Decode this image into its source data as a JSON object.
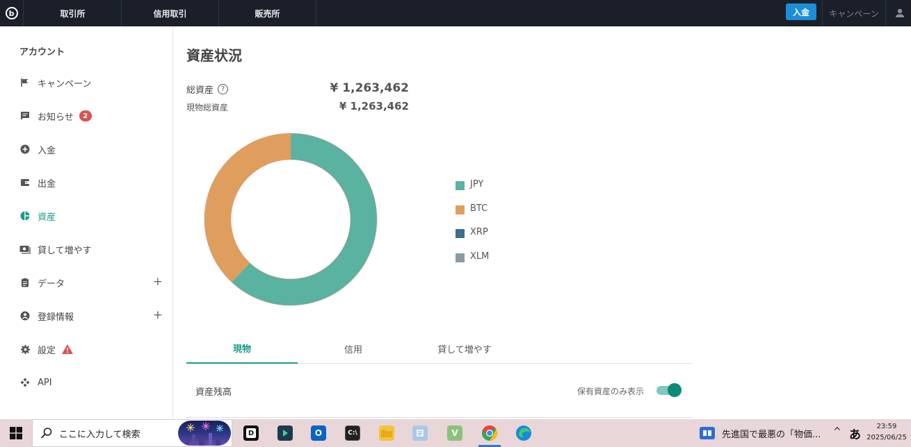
{
  "topbar": {
    "tabs": [
      "取引所",
      "信用取引",
      "販売所"
    ],
    "deposit_label": "入金",
    "campaign_label": "キャンペーン"
  },
  "sidebar": {
    "title": "アカウント",
    "items": [
      {
        "label": "キャンペーン",
        "icon": "flag-icon"
      },
      {
        "label": "お知らせ",
        "icon": "message-icon",
        "badge": "2"
      },
      {
        "label": "入金",
        "icon": "plus-circle-icon"
      },
      {
        "label": "出金",
        "icon": "wallet-icon"
      },
      {
        "label": "資産",
        "icon": "pie-chart-icon",
        "active": true
      },
      {
        "label": "貸して増やす",
        "icon": "cash-icon"
      },
      {
        "label": "データ",
        "icon": "clipboard-icon",
        "expandable": true
      },
      {
        "label": "登録情報",
        "icon": "account-circle-icon",
        "expandable": true
      },
      {
        "label": "設定",
        "icon": "gear-icon",
        "warning": true
      },
      {
        "label": "API",
        "icon": "api-icon"
      }
    ]
  },
  "main": {
    "title": "資産状況",
    "total_assets_label": "総資産",
    "total_assets_value": "¥ 1,263,462",
    "spot_assets_label": "現物総資産",
    "spot_assets_value": "¥ 1,263,462",
    "tabs": [
      {
        "label": "現物",
        "active": true
      },
      {
        "label": "信用"
      },
      {
        "label": "貸して増やす"
      }
    ],
    "balance_label": "資産残高",
    "toggle_label": "保有資産のみ表示",
    "toggle_on": true
  },
  "chart_data": {
    "type": "pie",
    "donut": true,
    "categories": [
      "JPY",
      "BTC",
      "XRP",
      "XLM"
    ],
    "values": [
      62,
      38,
      0,
      0
    ],
    "colors": [
      "#5ab2a1",
      "#e09e5e",
      "#3e6f8e",
      "#8a9aa5"
    ],
    "legend_position": "right"
  },
  "taskbar": {
    "search_placeholder": "ここに入力して検索",
    "news_text": "先進国で最悪の「物価...",
    "ime": "あ",
    "time": "23:59",
    "date": "2025/06/25"
  }
}
